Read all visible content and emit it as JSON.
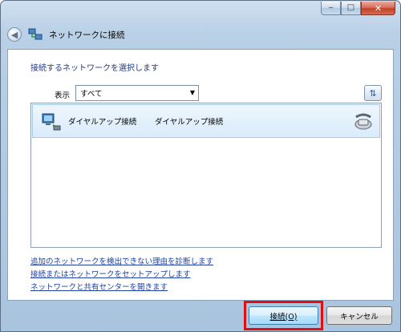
{
  "window": {
    "title": "ネットワークに接続",
    "caption": {
      "minimize": "‒",
      "maximize": "□",
      "close": "✕"
    }
  },
  "content": {
    "instruction": "接続するネットワークを選択します",
    "filter": {
      "label": "表示",
      "value": "すべて"
    },
    "networks": [
      {
        "name": "ダイヤルアップ接続",
        "type": "ダイヤルアップ接続",
        "icon": "dialup-connection-icon"
      }
    ],
    "links": [
      "追加のネットワークを検出できない理由を診断します",
      "接続またはネットワークをセットアップします",
      "ネットワークと共有センターを開きます"
    ]
  },
  "buttons": {
    "connect": "接続(O)",
    "cancel": "キャンセル"
  },
  "colors": {
    "highlight": "#e01010",
    "link": "#2040a0",
    "instruction": "#1e3a8c"
  }
}
